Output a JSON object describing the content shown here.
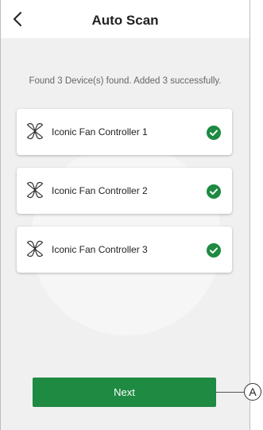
{
  "header": {
    "title": "Auto Scan",
    "back_icon": "chevron-left-icon"
  },
  "status_text": "Found 3 Device(s) found. Added 3 successfully.",
  "devices": [
    {
      "name": "Iconic Fan Controller 1",
      "icon": "fan-icon",
      "status_icon": "check-circle-icon"
    },
    {
      "name": "Iconic Fan Controller 2",
      "icon": "fan-icon",
      "status_icon": "check-circle-icon"
    },
    {
      "name": "Iconic Fan Controller 3",
      "icon": "fan-icon",
      "status_icon": "check-circle-icon"
    }
  ],
  "next_label": "Next",
  "callout_label": "A",
  "colors": {
    "accent": "#1e8a42",
    "background": "#f0f0f0",
    "card": "#ffffff"
  }
}
